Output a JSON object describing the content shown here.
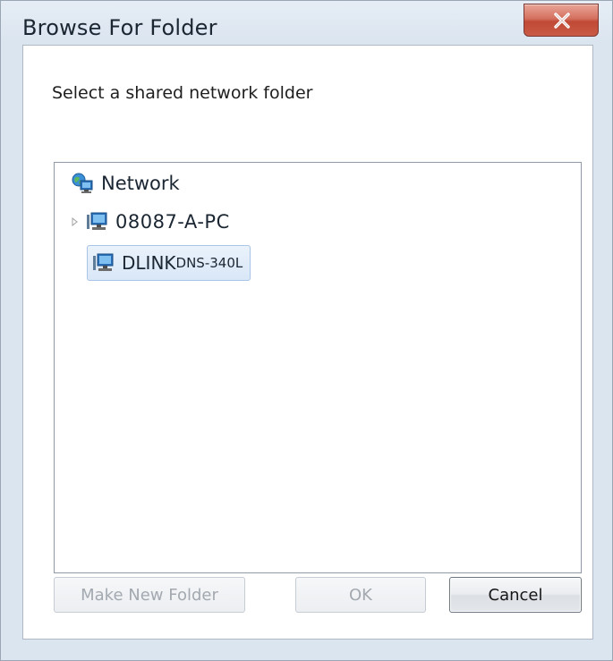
{
  "window": {
    "title": "Browse For Folder",
    "close_icon": "close-icon"
  },
  "prompt": "Select a shared network folder",
  "tree": {
    "root": {
      "label": "Network",
      "icon": "network-icon"
    },
    "items": [
      {
        "label": "08087-A-PC",
        "sublabel": "",
        "icon": "computer-icon",
        "expandable": true,
        "selected": false
      },
      {
        "label": "DLINK",
        "sublabel": "DNS-340L",
        "icon": "computer-icon",
        "expandable": false,
        "selected": true
      }
    ]
  },
  "buttons": {
    "make_new_folder": {
      "label": "Make New Folder",
      "enabled": false
    },
    "ok": {
      "label": "OK",
      "enabled": false
    },
    "cancel": {
      "label": "Cancel",
      "enabled": true
    }
  },
  "colors": {
    "selection_bg": "#d9e7f7",
    "selection_border": "#a8c4e6",
    "close_button": "#c95a45",
    "disabled_text": "#a3a9b0"
  }
}
